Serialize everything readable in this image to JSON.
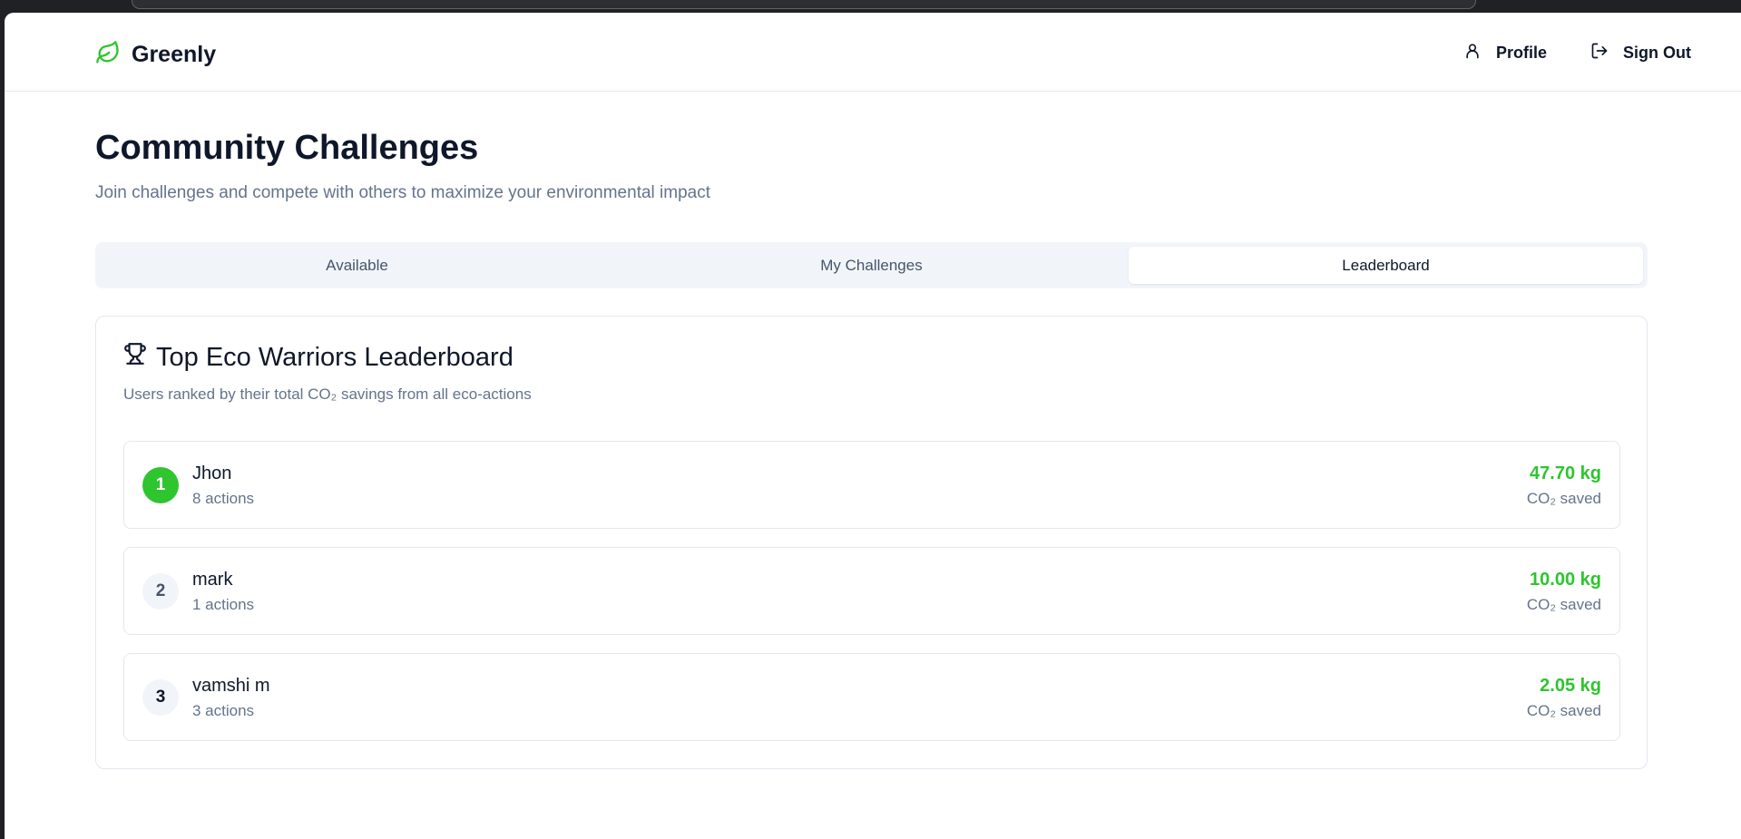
{
  "app": {
    "name": "Greenly"
  },
  "nav": {
    "profile_label": "Profile",
    "signout_label": "Sign Out"
  },
  "page": {
    "title": "Community Challenges",
    "subtitle": "Join challenges and compete with others to maximize your environmental impact"
  },
  "tabs": [
    {
      "label": "Available",
      "active": false
    },
    {
      "label": "My Challenges",
      "active": false
    },
    {
      "label": "Leaderboard",
      "active": true
    }
  ],
  "leaderboard": {
    "title": "Top Eco Warriors Leaderboard",
    "subtitle": "Users ranked by their total CO₂ savings from all eco-actions",
    "rows": [
      {
        "rank": "1",
        "name": "Jhon",
        "actions": "8 actions",
        "amount": "47.70 kg",
        "amount_label": "CO₂ saved"
      },
      {
        "rank": "2",
        "name": "mark",
        "actions": "1 actions",
        "amount": "10.00 kg",
        "amount_label": "CO₂ saved"
      },
      {
        "rank": "3",
        "name": "vamshi m",
        "actions": "3 actions",
        "amount": "2.05 kg",
        "amount_label": "CO₂ saved"
      }
    ]
  },
  "colors": {
    "accent": "#2ec52e",
    "muted": "#64748b",
    "text": "#0f172a"
  },
  "icons": {
    "brand": "leaf-icon",
    "profile": "user-icon",
    "signout": "log-out-icon",
    "leaderboard": "trophy-icon"
  }
}
